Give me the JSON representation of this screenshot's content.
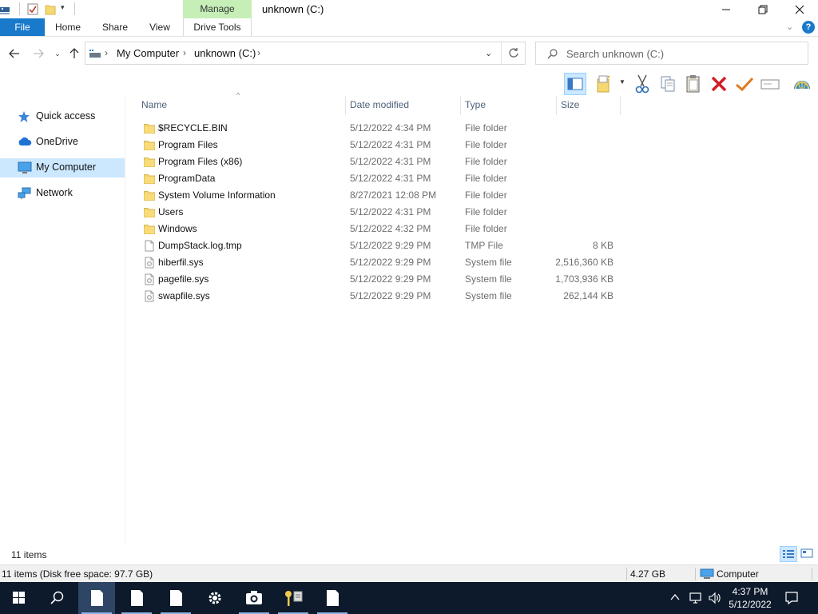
{
  "window": {
    "title": "unknown (C:)",
    "contextual_tab_group": "Manage"
  },
  "ribbon": {
    "tabs": [
      "File",
      "Home",
      "Share",
      "View",
      "Drive Tools"
    ]
  },
  "address": {
    "breadcrumbs": [
      "My Computer",
      "unknown (C:)"
    ]
  },
  "search": {
    "placeholder": "Search unknown (C:)"
  },
  "nav_pane": {
    "items": [
      {
        "label": "Quick access",
        "icon": "star-icon"
      },
      {
        "label": "OneDrive",
        "icon": "cloud-icon"
      },
      {
        "label": "My Computer",
        "icon": "computer-icon",
        "selected": true
      },
      {
        "label": "Network",
        "icon": "network-icon"
      }
    ]
  },
  "file_list": {
    "columns": [
      "Name",
      "Date modified",
      "Type",
      "Size"
    ],
    "rows": [
      {
        "name": "$RECYCLE.BIN",
        "date": "5/12/2022 4:34 PM",
        "type": "File folder",
        "size": "",
        "icon": "folder-icon"
      },
      {
        "name": "Program Files",
        "date": "5/12/2022 4:31 PM",
        "type": "File folder",
        "size": "",
        "icon": "folder-icon"
      },
      {
        "name": "Program Files (x86)",
        "date": "5/12/2022 4:31 PM",
        "type": "File folder",
        "size": "",
        "icon": "folder-icon"
      },
      {
        "name": "ProgramData",
        "date": "5/12/2022 4:31 PM",
        "type": "File folder",
        "size": "",
        "icon": "folder-icon"
      },
      {
        "name": "System Volume Information",
        "date": "8/27/2021 12:08 PM",
        "type": "File folder",
        "size": "",
        "icon": "folder-icon"
      },
      {
        "name": "Users",
        "date": "5/12/2022 4:31 PM",
        "type": "File folder",
        "size": "",
        "icon": "folder-icon"
      },
      {
        "name": "Windows",
        "date": "5/12/2022 4:32 PM",
        "type": "File folder",
        "size": "",
        "icon": "folder-icon"
      },
      {
        "name": "DumpStack.log.tmp",
        "date": "5/12/2022 9:29 PM",
        "type": "TMP File",
        "size": "8 KB",
        "icon": "file-icon"
      },
      {
        "name": "hiberfil.sys",
        "date": "5/12/2022 9:29 PM",
        "type": "System file",
        "size": "2,516,360 KB",
        "icon": "system-file-icon"
      },
      {
        "name": "pagefile.sys",
        "date": "5/12/2022 9:29 PM",
        "type": "System file",
        "size": "1,703,936 KB",
        "icon": "system-file-icon"
      },
      {
        "name": "swapfile.sys",
        "date": "5/12/2022 9:29 PM",
        "type": "System file",
        "size": "262,144 KB",
        "icon": "system-file-icon"
      }
    ]
  },
  "status": {
    "item_count": "11 items",
    "summary": "11 items (Disk free space: 97.7 GB)",
    "size": "4.27 GB",
    "location": "Computer"
  },
  "taskbar": {
    "time": "4:37 PM",
    "date": "5/12/2022"
  },
  "colors": {
    "accent": "#1979ca",
    "manage_tab": "#c6efb8",
    "selection": "#cce8ff",
    "taskbar": "#0d1a2b",
    "folder": "#f5d774"
  }
}
